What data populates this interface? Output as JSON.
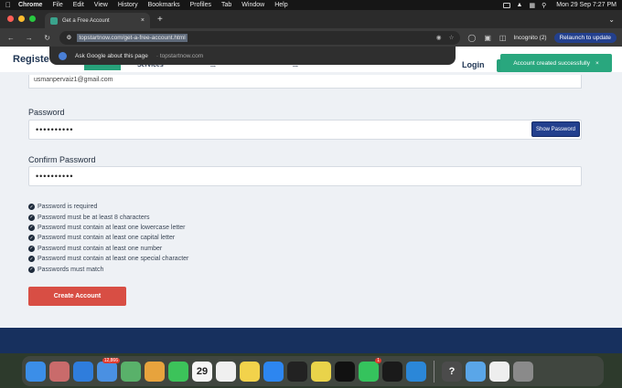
{
  "menubar": {
    "apple": "",
    "items": [
      "Chrome",
      "File",
      "Edit",
      "View",
      "History",
      "Bookmarks",
      "Profiles",
      "Tab",
      "Window",
      "Help"
    ],
    "clock": "Mon 29 Sep 7:27 PM"
  },
  "tabs": [
    {
      "title": "Get a Free Account"
    }
  ],
  "newtab_label": "+",
  "toolbar": {
    "url": "topstartnow.com/get-a-free-account.html",
    "incognito_label": "Incognito (2)",
    "relaunch_label": "Relaunch to update"
  },
  "suggestion": {
    "title": "Ask Google about this page",
    "subtitle": "· topstartnow.com"
  },
  "site": {
    "brand": "Registe",
    "nav_links": [
      "Services",
      "...",
      "..."
    ],
    "login_label": "Login"
  },
  "toast": {
    "message": "Account created successfully",
    "close": "×"
  },
  "form": {
    "email_value": "usmanpervaiz1@gmail.com",
    "password_label": "Password",
    "password_value": "••••••••••",
    "show_password_label": "Show Password",
    "confirm_label": "Confirm Password",
    "confirm_value": "••••••••••",
    "rules": [
      "Password is required",
      "Password must be at least 8 characters",
      "Password must contain at least one lowercase letter",
      "Password must contain at least one capital letter",
      "Password must contain at least one number",
      "Password must contain at least one special character",
      "Passwords must match"
    ],
    "submit_label": "Create Account"
  },
  "dock": {
    "apps": [
      {
        "name": "finder",
        "color": "#3b8ee8"
      },
      {
        "name": "launchpad",
        "color": "#c96b6b"
      },
      {
        "name": "safari",
        "color": "#2f7ddc"
      },
      {
        "name": "mail",
        "color": "#4a90e2",
        "badge": "12,866"
      },
      {
        "name": "maps",
        "color": "#59b16a"
      },
      {
        "name": "photos",
        "color": "#e7a33d"
      },
      {
        "name": "facetime",
        "color": "#3cc35a"
      },
      {
        "name": "calendar",
        "color": "#f5f5f5",
        "text": "29"
      },
      {
        "name": "reminders",
        "color": "#f0f0f0"
      },
      {
        "name": "notes",
        "color": "#f2d24b"
      },
      {
        "name": "app-store",
        "color": "#2d86f0"
      },
      {
        "name": "terminal",
        "color": "#222222"
      },
      {
        "name": "chrome",
        "color": "#e9d34a"
      },
      {
        "name": "capcut",
        "color": "#111111"
      },
      {
        "name": "whatsapp",
        "color": "#35c35d",
        "badge": "1"
      },
      {
        "name": "cube-app",
        "color": "#1a1a1a"
      },
      {
        "name": "vscode",
        "color": "#2b87d8"
      },
      {
        "name": "help",
        "color": "#4b4b4b",
        "text": "?"
      },
      {
        "name": "folder",
        "color": "#5aa6e8"
      },
      {
        "name": "preview",
        "color": "#eeeeee"
      },
      {
        "name": "trash",
        "color": "#8a8a8a"
      }
    ]
  }
}
